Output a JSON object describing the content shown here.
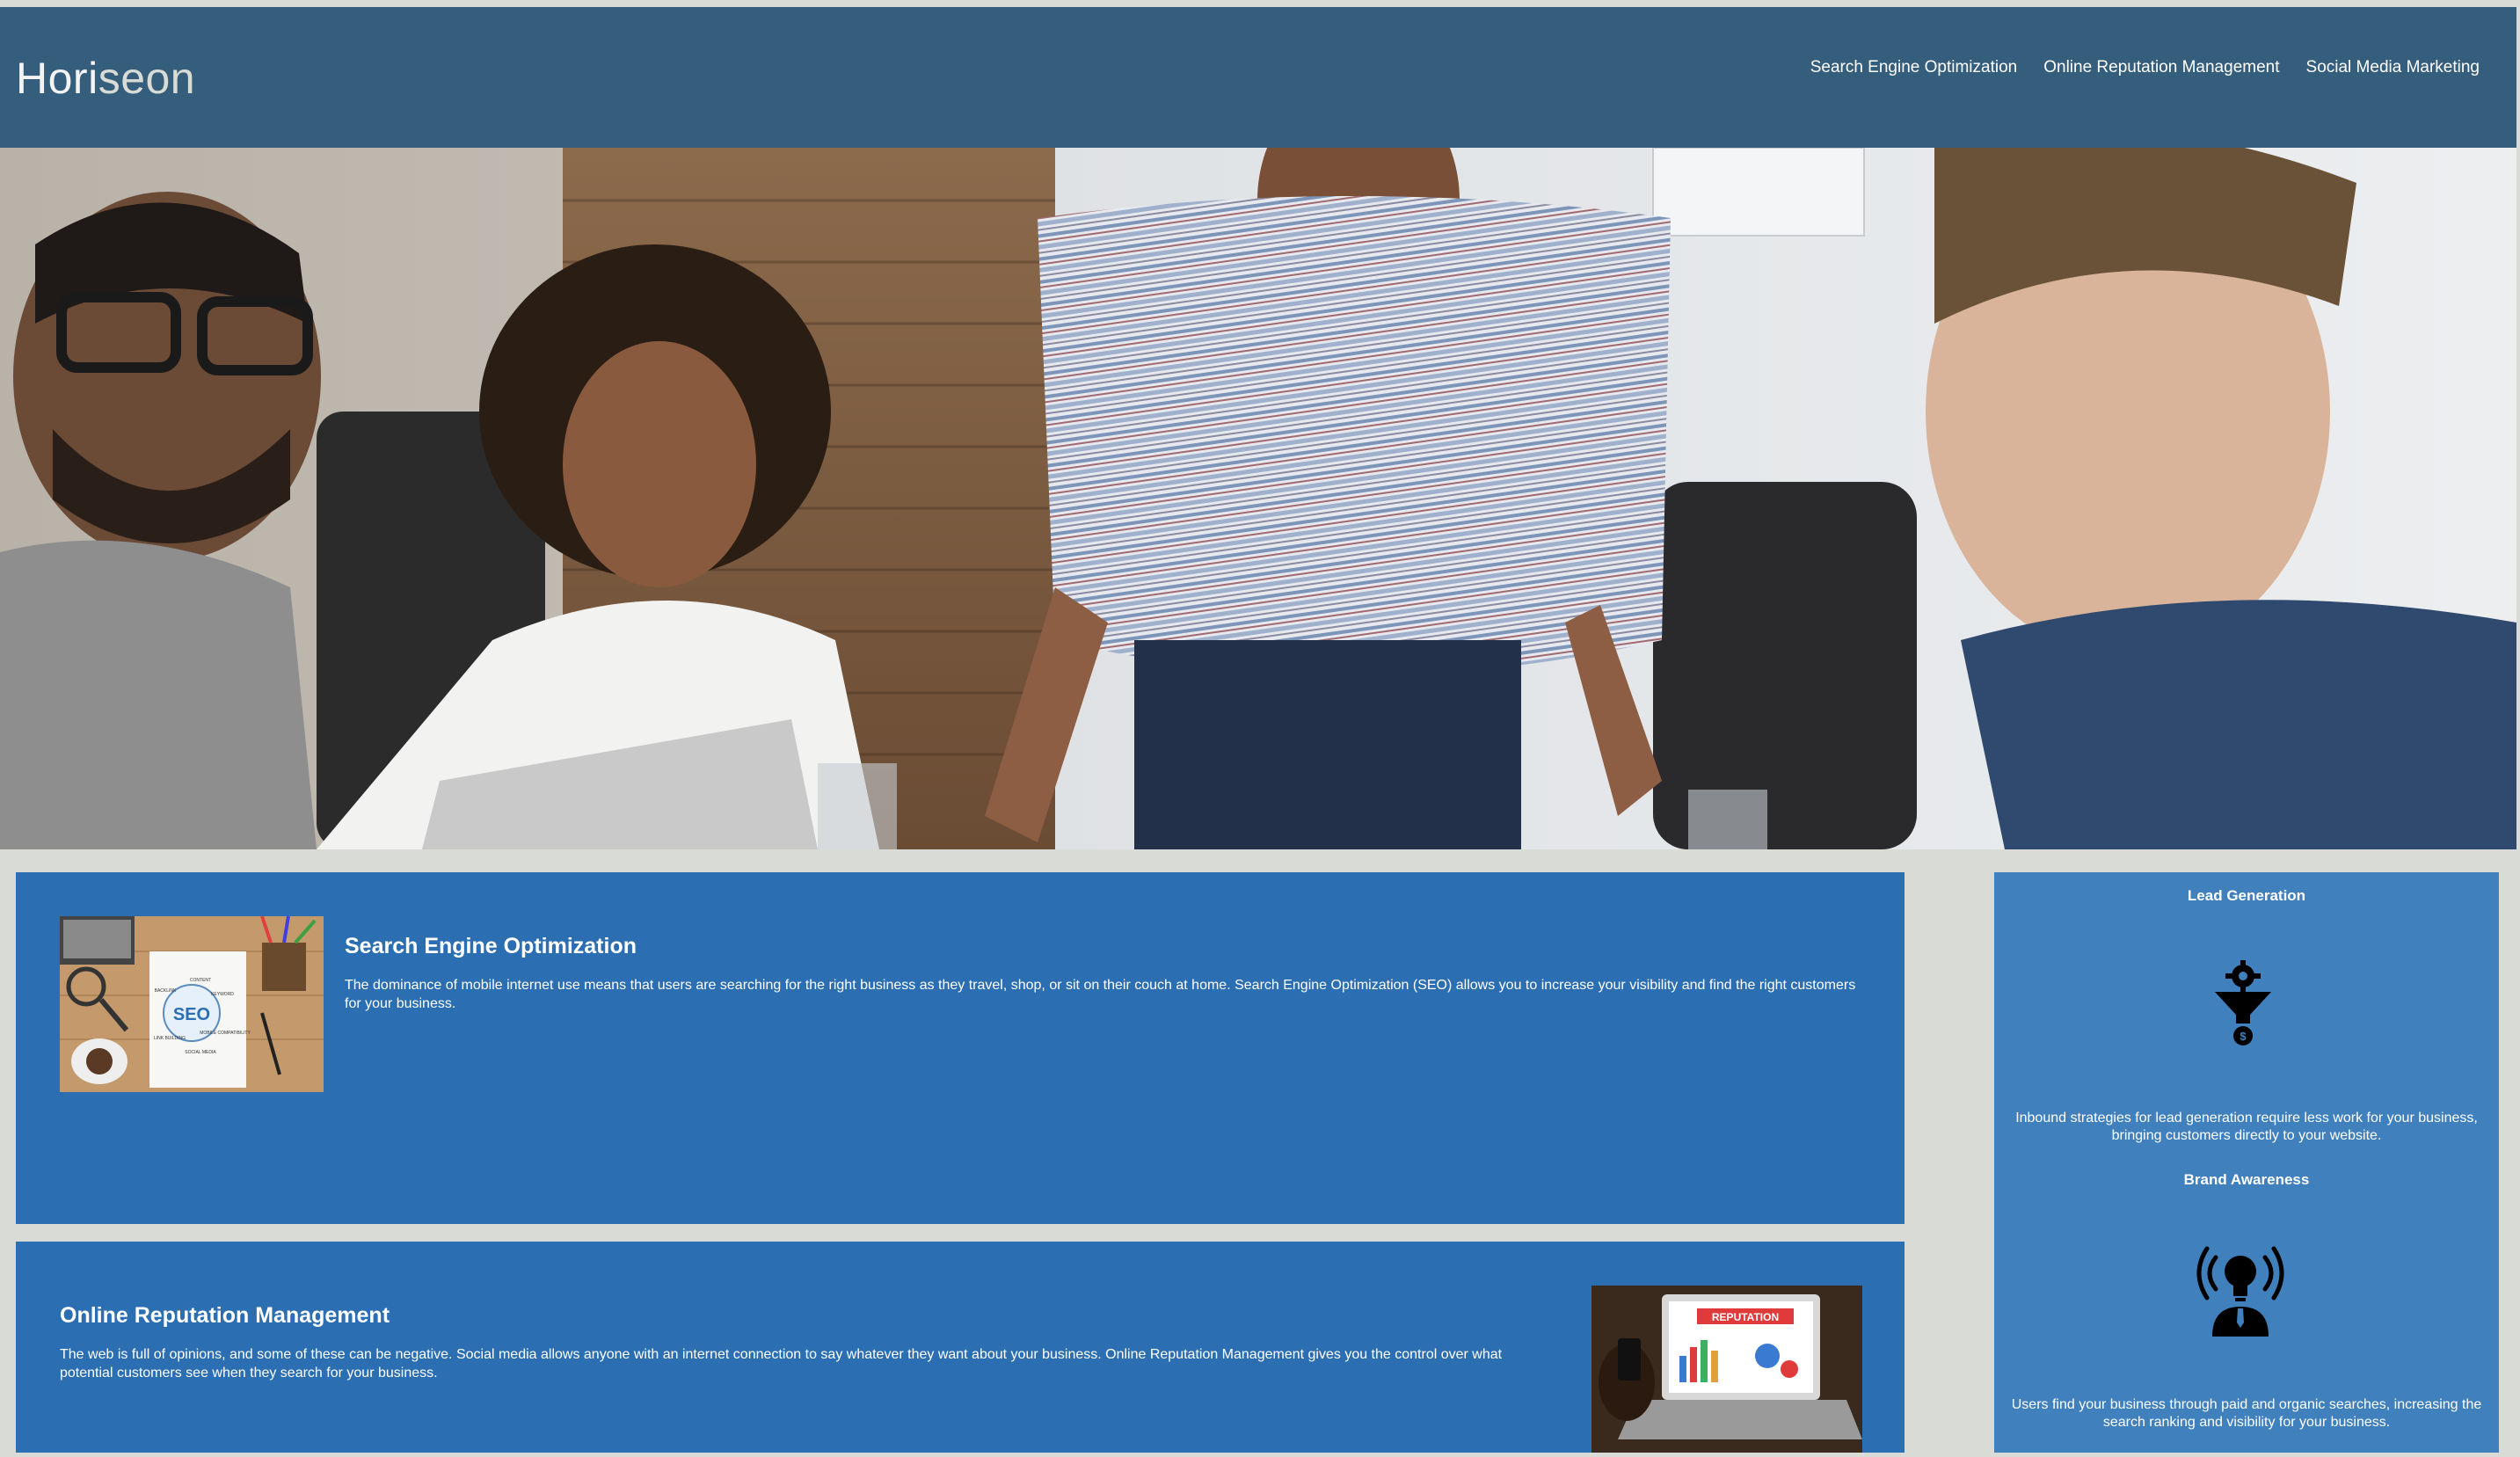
{
  "header": {
    "logo_part1": "Hori",
    "logo_part2": "seon",
    "nav": [
      "Search Engine Optimization",
      "Online Reputation Management",
      "Social Media Marketing"
    ]
  },
  "hero": {
    "icon": "team-meeting-photo"
  },
  "content": [
    {
      "title": "Search Engine Optimization",
      "text": "The dominance of mobile internet use means that users are searching for the right business as they travel, shop, or sit on their couch at home. Search Engine Optimization (SEO) allows you to increase your visibility and find the right customers for your business.",
      "image_label": "SEO",
      "image_words": [
        "CONTENT",
        "BACKLINK",
        "KEYWORD",
        "LINK BUILDING",
        "MOBILE COMPATIBILITY",
        "SOCIAL MEDIA"
      ]
    },
    {
      "title": "Online Reputation Management",
      "text": "The web is full of opinions, and some of these can be negative. Social media allows anyone with an internet connection to say whatever they want about your business. Online Reputation Management gives you the control over what potential customers see when they search for your business.",
      "image_label": "REPUTATION"
    }
  ],
  "benefits": [
    {
      "title": "Lead Generation",
      "icon": "lead-funnel-icon",
      "text": "Inbound strategies for lead generation require less work for your business, bringing customers directly to your website."
    },
    {
      "title": "Brand Awareness",
      "icon": "lightbulb-broadcast-icon",
      "text": "Users find your business through paid and organic searches, increasing the search ranking and visibility for your business."
    }
  ],
  "colors": {
    "header_bg": "#355e7c",
    "page_bg": "#d9dcd6",
    "card_bg": "#2b6eb1",
    "aside_bg": "#3f80bd"
  }
}
